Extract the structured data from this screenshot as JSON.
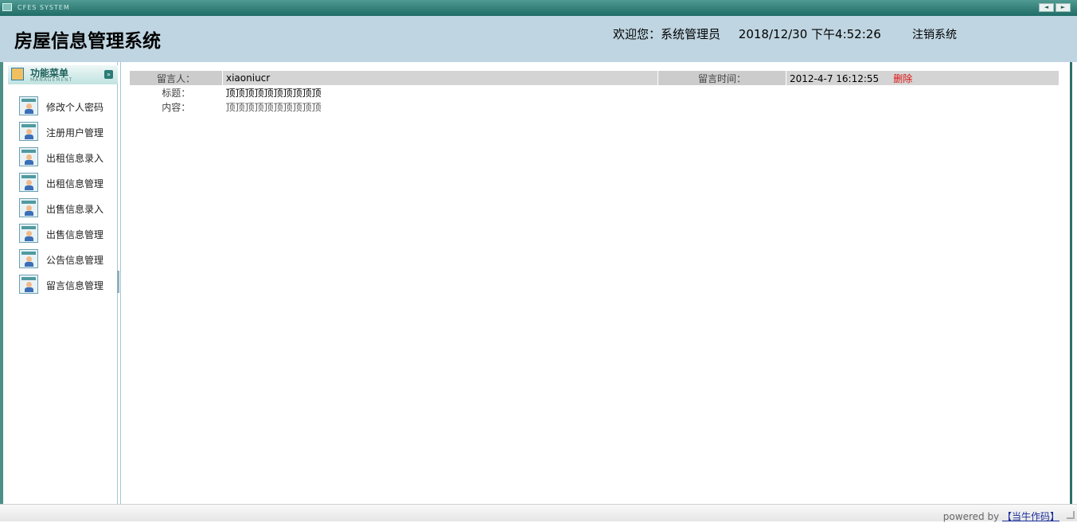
{
  "window": {
    "system_title": "CFES SYSTEM",
    "nav_prev": "◄",
    "nav_next": "►"
  },
  "header": {
    "title": "房屋信息管理系统",
    "welcome": "欢迎您：系统管理员",
    "datetime": "2018/12/30 下午4:52:26",
    "logout": "注销系统"
  },
  "sidebar": {
    "menu_title": "功能菜单",
    "menu_subtitle": "MANAGEMENT",
    "toggle": "»",
    "items": [
      {
        "label": "修改个人密码"
      },
      {
        "label": "注册用户管理"
      },
      {
        "label": "出租信息录入"
      },
      {
        "label": "出租信息管理"
      },
      {
        "label": "出售信息录入"
      },
      {
        "label": "出售信息管理"
      },
      {
        "label": "公告信息管理"
      },
      {
        "label": "留言信息管理"
      }
    ]
  },
  "message": {
    "author_label": "留言人：",
    "author": "xiaoniucr",
    "time_label": "留言时间：",
    "time": "2012-4-7 16:12:55",
    "delete": "删除",
    "subject_label": "标题：",
    "subject": "顶顶顶顶顶顶顶顶顶顶",
    "content_label": "内容：",
    "content": "顶顶顶顶顶顶顶顶顶顶"
  },
  "footer": {
    "powered": "powered by ",
    "author_link": "【当牛作码】"
  }
}
